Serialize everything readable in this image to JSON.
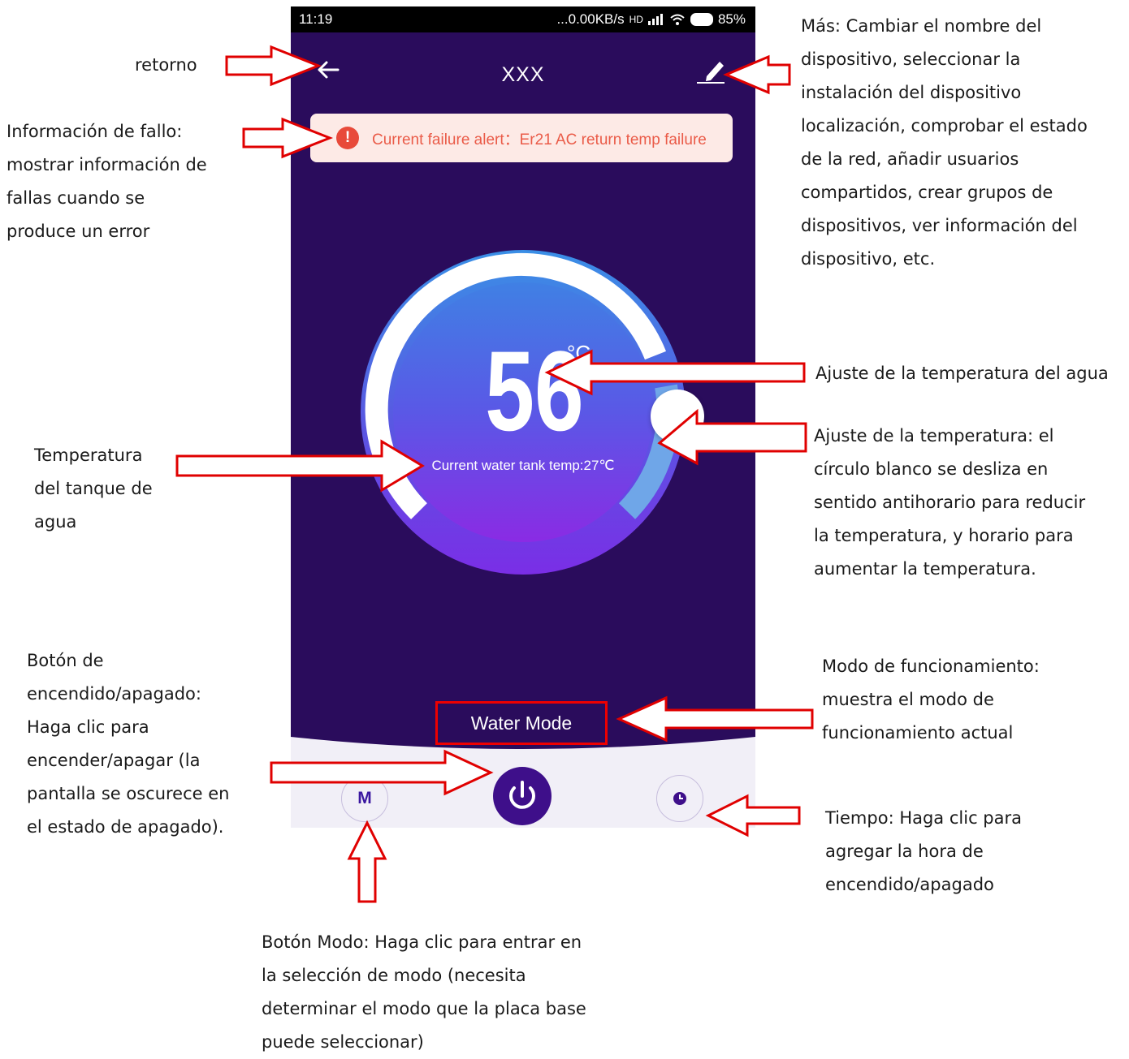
{
  "status_bar": {
    "time": "11:19",
    "network": "...0.00KB/s",
    "signal": "HD",
    "battery": "85%"
  },
  "app": {
    "title": "XXX",
    "alert_icon": "!",
    "alert_text": "Current failure alert：Er21 AC return temp failure",
    "temperature": "56",
    "temperature_unit": "°C",
    "tank_temp_text": "Current water tank temp:27℃",
    "mode_label": "Water Mode",
    "mode_button": "M"
  },
  "icons": {
    "back": "arrow-left-icon",
    "edit": "pencil-icon",
    "alert": "exclamation-icon",
    "power": "power-icon",
    "timer": "clock-icon"
  },
  "colors": {
    "phone_bg": "#2a0c5c",
    "accent": "#3e0f8a",
    "alert_bg": "#fdeae6",
    "alert_text": "#ea5b48",
    "annotation_arrow": "#e00000"
  },
  "annotations": {
    "return": [
      "retorno"
    ],
    "failure": [
      "Información de fallo:",
      "mostrar información de",
      "fallas cuando se",
      "produce un error"
    ],
    "more": [
      "Más: Cambiar el nombre del",
      "dispositivo, seleccionar la",
      "instalación del dispositivo",
      "localización, comprobar el estado",
      "de la red, añadir usuarios",
      "compartidos, crear grupos de",
      "dispositivos, ver información del",
      "dispositivo, etc."
    ],
    "water_temp_setting": [
      "Ajuste de la temperatura del agua"
    ],
    "temp_adjust": [
      "Ajuste de la temperatura: el",
      "círculo blanco se desliza en",
      "sentido antihorario para reducir",
      "la temperatura, y horario para",
      "aumentar la temperatura."
    ],
    "tank_temp": [
      "Temperatura",
      "del tanque de",
      "agua"
    ],
    "power_button": [
      "Botón de",
      "encendido/apagado:",
      "Haga clic para",
      "encender/apagar (la",
      "pantalla se oscurece en",
      "el estado de apagado)."
    ],
    "operating_mode": [
      "Modo de funcionamiento:",
      "muestra el modo de",
      "funcionamiento actual"
    ],
    "timer": [
      "Tiempo: Haga clic para",
      "agregar la hora de",
      "encendido/apagado"
    ],
    "mode_button": [
      "Botón Modo: Haga clic para entrar en",
      "la selección de modo (necesita",
      "determinar el modo que la placa base",
      "puede seleccionar)"
    ]
  }
}
